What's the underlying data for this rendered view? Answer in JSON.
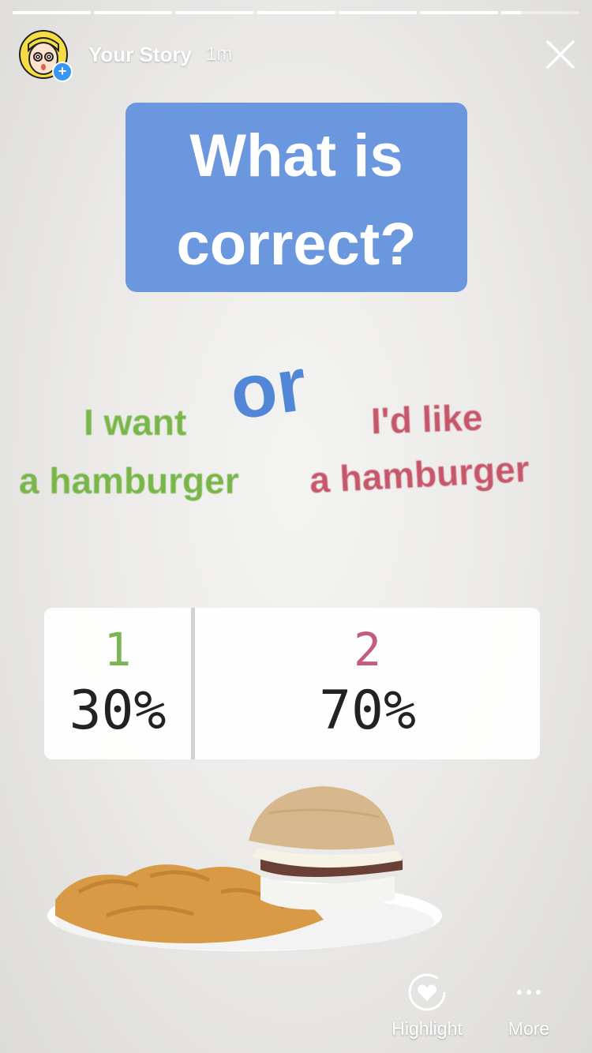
{
  "header": {
    "username": "Your Story",
    "time": "1m"
  },
  "progress": {
    "segments": 7,
    "current_segment_fill": 0.25
  },
  "title": {
    "line1": "What is",
    "line2": "correct?"
  },
  "options": {
    "or": "or",
    "option1_line1": "I want",
    "option1_line2": "a hamburger",
    "option2_line1": "I'd like",
    "option2_line2": "a hamburger"
  },
  "poll": {
    "choices": [
      {
        "label": "1",
        "percent": "30%"
      },
      {
        "label": "2",
        "percent": "70%"
      }
    ]
  },
  "footer": {
    "highlight_label": "Highlight",
    "more_label": "More"
  },
  "icons": {
    "close": "close-icon",
    "highlight": "heart-circle-icon",
    "more": "more-dots-icon"
  },
  "colors": {
    "title_bg": "#6a97dd",
    "option1": "#78b64a",
    "option2": "#c6576a",
    "or": "#5286d6"
  }
}
